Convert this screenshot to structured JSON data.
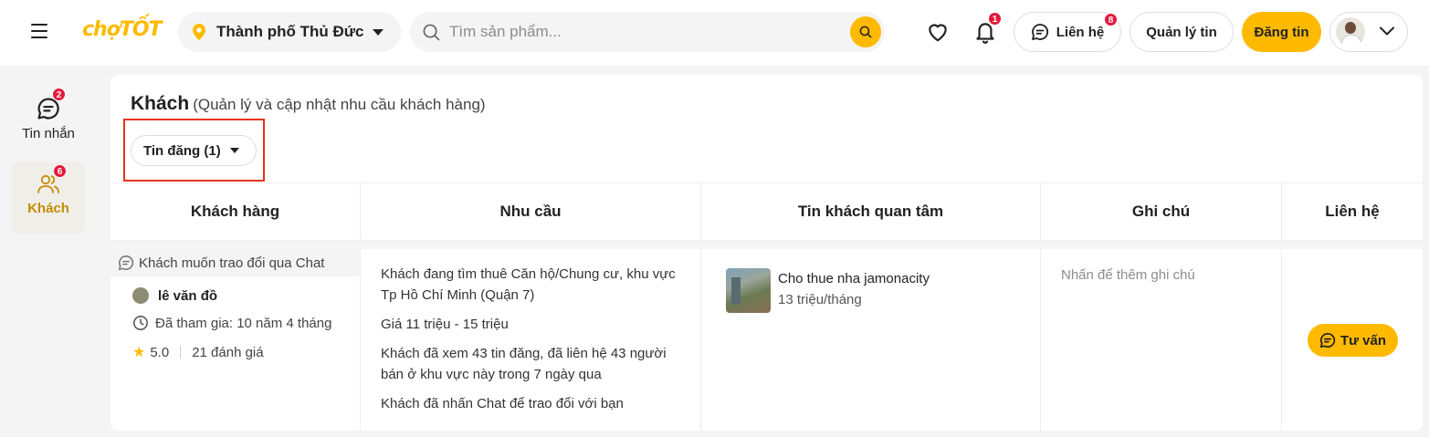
{
  "header": {
    "logo": "chợTỐT",
    "location": "Thành phố Thủ Đức",
    "search_placeholder": "Tìm sản phẩm...",
    "notification_count": "1",
    "contact_label": "Liên hệ",
    "contact_count": "8",
    "manage_label": "Quản lý tin",
    "post_label": "Đăng tin"
  },
  "sidebar": {
    "items": [
      {
        "label": "Tin nhắn",
        "badge": "2",
        "icon": "chat-icon"
      },
      {
        "label": "Khách",
        "badge": "6",
        "icon": "users-icon",
        "active": true
      }
    ]
  },
  "page": {
    "title": "Khách",
    "subtitle": "(Quản lý và cập nhật nhu cầu khách hàng)",
    "filter_label": "Tin đăng (1)"
  },
  "table": {
    "columns": [
      "Khách hàng",
      "Nhu cầu",
      "Tin khách quan tâm",
      "Ghi chú",
      "Liên hệ"
    ],
    "rows": [
      {
        "channel": "Khách muốn trao đổi qua Chat",
        "customer_name": "lê văn đồ",
        "joined": "Đã tham gia: 10 năm 4 tháng",
        "rating": "5.0",
        "reviews": "21 đánh giá",
        "needs": [
          "Khách đang tìm thuê Căn hộ/Chung cư, khu vực Tp Hồ Chí Minh (Quận 7)",
          "Giá 11 triệu - 15 triệu",
          "Khách đã xem 43 tin đăng, đã liên hệ 43 người bán ở khu vực này trong 7 ngày qua",
          "Khách đã nhấn Chat để trao đổi với bạn"
        ],
        "listing_title": "Cho thue nha jamonacity",
        "listing_price": "13 triệu/tháng",
        "note_placeholder": "Nhấn để thêm ghi chú",
        "action_label": "Tư vấn"
      }
    ]
  },
  "colors": {
    "brand": "#ffba00",
    "badge": "#e5193b",
    "highlight": "#e5341d"
  }
}
